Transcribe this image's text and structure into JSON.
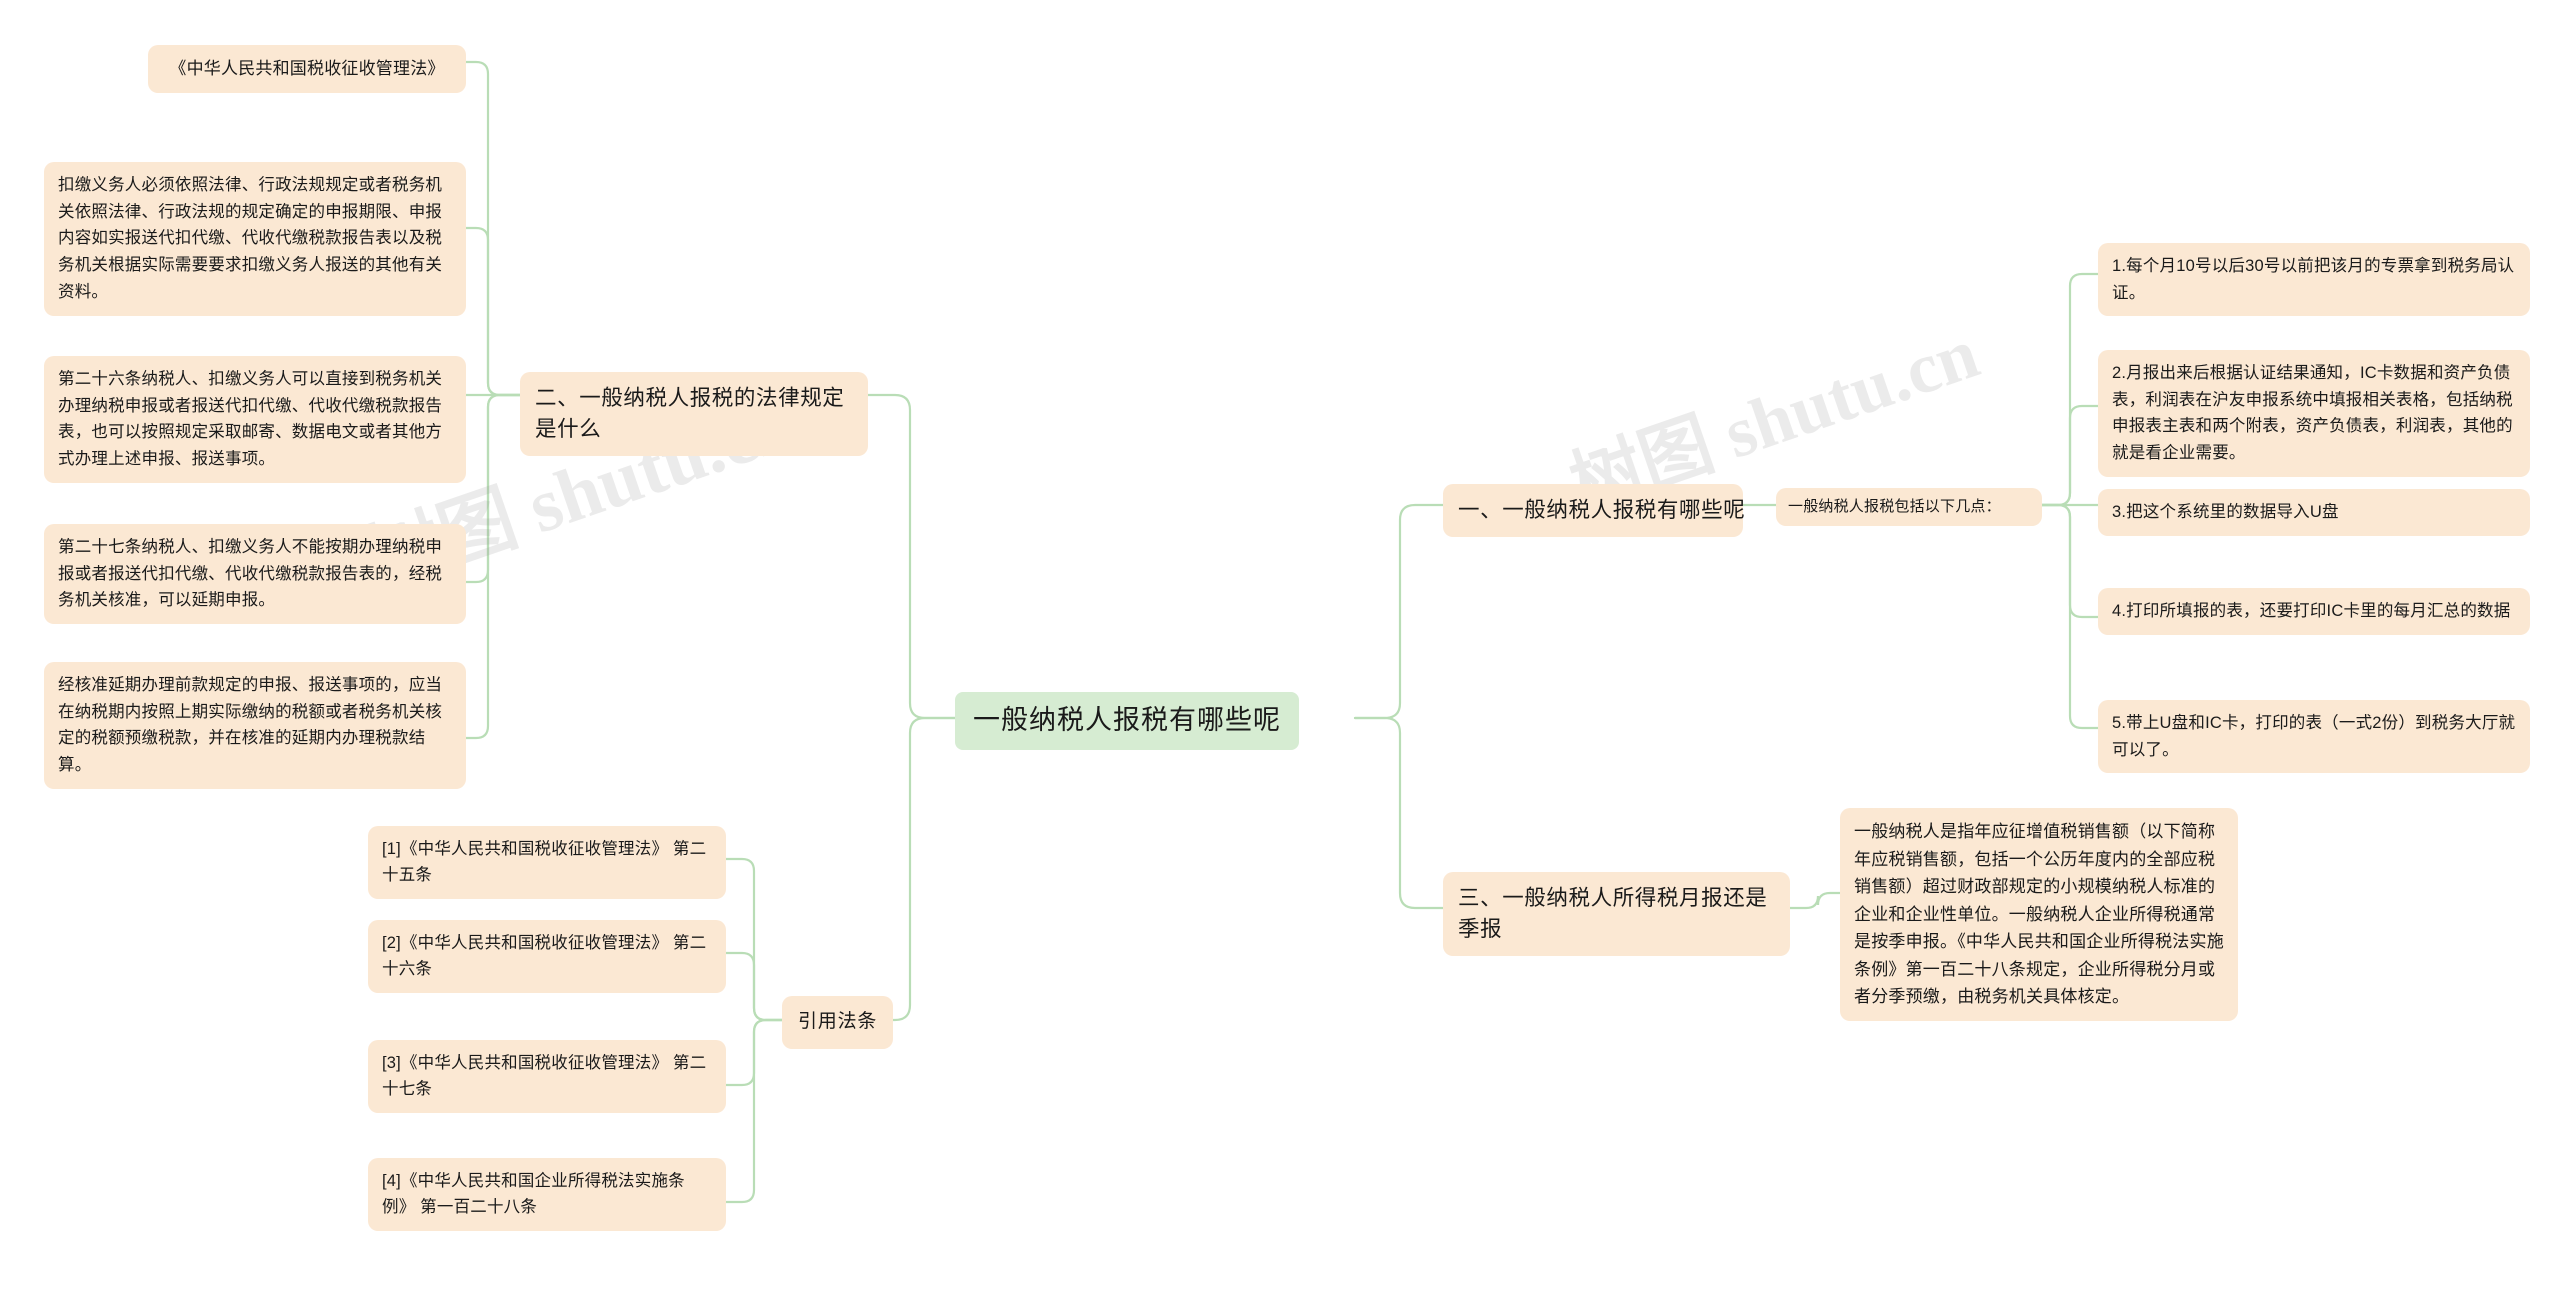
{
  "page": {
    "background": "#ffffff",
    "node_fill": "#fbe8d3",
    "root_fill": "#d6ecd2",
    "link_color": "#b9ddb6",
    "text_color": "#1a1a1a"
  },
  "watermarks": {
    "left": "树图 shutu.cn",
    "right": "树图 shutu.cn"
  },
  "root": {
    "label": "一般纳税人报税有哪些呢"
  },
  "branches": [
    {
      "id": "branch-1",
      "label": "一、一般纳税人报税有哪些呢",
      "side": "right",
      "intro": "一般纳税人报税包括以下几点：",
      "items": [
        "1.每个月10号以后30号以前把该月的专票拿到税务局认证。",
        "2.月报出来后根据认证结果通知，IC卡数据和资产负债表，利润表在沪友申报系统中填报相关表格，包括纳税申报表主表和两个附表，资产负债表，利润表，其他的就是看企业需要。",
        "3.把这个系统里的数据导入U盘",
        "4.打印所填报的表，还要打印IC卡里的每月汇总的数据",
        "5.带上U盘和IC卡，打印的表（一式2份）到税务大厅就可以了。"
      ]
    },
    {
      "id": "branch-2",
      "label": "二、一般纳税人报税的法律规定是什么",
      "side": "left",
      "law_title": "《中华人民共和国税收征收管理法》",
      "items": [
        "扣缴义务人必须依照法律、行政法规规定或者税务机关依照法律、行政法规的规定确定的申报期限、申报内容如实报送代扣代缴、代收代缴税款报告表以及税务机关根据实际需要要求扣缴义务人报送的其他有关资料。",
        "第二十六条纳税人、扣缴义务人可以直接到税务机关办理纳税申报或者报送代扣代缴、代收代缴税款报告表，也可以按照规定采取邮寄、数据电文或者其他方式办理上述申报、报送事项。",
        "第二十七条纳税人、扣缴义务人不能按期办理纳税申报或者报送代扣代缴、代收代缴税款报告表的，经税务机关核准，可以延期申报。",
        "经核准延期办理前款规定的申报、报送事项的，应当在纳税期内按照上期实际缴纳的税额或者税务机关核定的税额预缴税款，并在核准的延期内办理税款结算。"
      ]
    },
    {
      "id": "branch-3",
      "label": "三、一般纳税人所得税月报还是季报",
      "side": "right",
      "items": [
        "一般纳税人是指年应征增值税销售额（以下简称年应税销售额，包括一个公历年度内的全部应税销售额）超过财政部规定的小规模纳税人标准的企业和企业性单位。一般纳税人企业所得税通常是按季申报。《中华人民共和国企业所得税法实施条例》第一百二十八条规定，企业所得税分月或者分季预缴，由税务机关具体核定。"
      ]
    },
    {
      "id": "branch-4",
      "label": "引用法条",
      "side": "left",
      "items": [
        "[1]《中华人民共和国税收征收管理法》 第二十五条",
        "[2]《中华人民共和国税收征收管理法》 第二十六条",
        "[3]《中华人民共和国税收征收管理法》 第二十七条",
        "[4]《中华人民共和国企业所得税法实施条例》 第一百二十八条"
      ]
    }
  ]
}
